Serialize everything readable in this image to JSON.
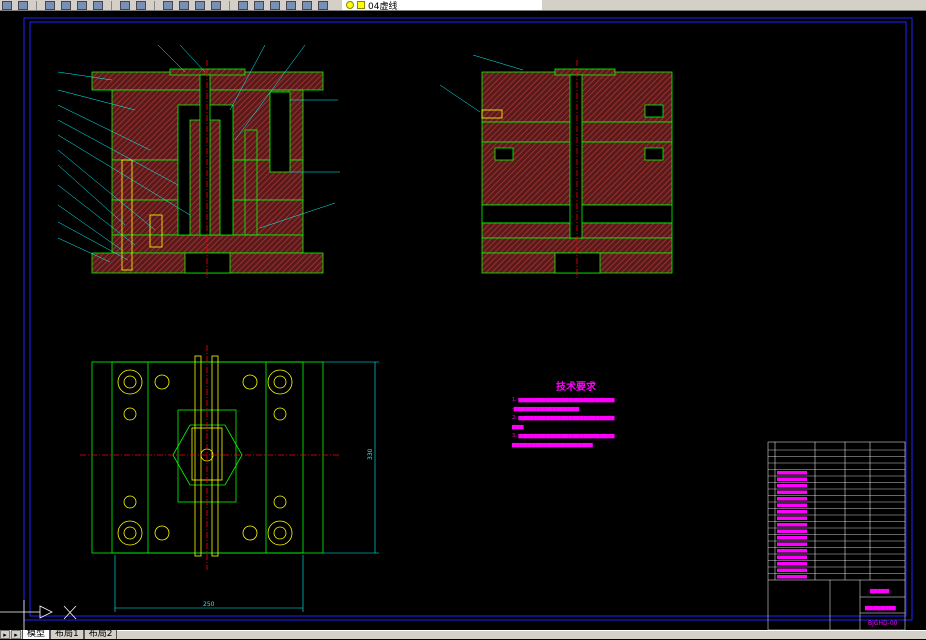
{
  "toolbar": {
    "layer_name": "04虚线",
    "icons": [
      "save-icon",
      "print-icon",
      "cut-icon",
      "copy-icon",
      "paste-icon",
      "match-properties-icon",
      "undo-icon",
      "redo-icon",
      "pan-icon",
      "zoom-realtime-icon",
      "zoom-window-icon",
      "zoom-previous-icon",
      "properties-icon",
      "design-center-icon",
      "tool-palettes-icon",
      "calculator-icon",
      "help-icon",
      "layers-icon"
    ]
  },
  "drawing": {
    "tech_title": "技术要求",
    "tech_lines": [
      "1. ▆▆▆▆▆▆▆▆▆▆▆▆▆▆▆▆▆▆▆▆▆▆▆▆▆",
      "-▆▆▆▆▆▆▆▆▆▆▆▆▆▆▆▆▆",
      "2. ▆▆▆▆▆▆▆▆▆▆▆▆▆▆▆▆▆▆▆▆▆▆▆▆▆",
      "▆▆▆",
      "3. ▆▆▆▆▆▆▆▆▆▆▆▆▆▆▆▆▆▆▆▆▆▆▆▆▆",
      "▆▆▆▆▆▆▆▆▆▆▆▆▆▆▆▆▆▆▆▆▆"
    ],
    "dim_width": "250",
    "dim_height": "330",
    "title_block": {
      "school": "▆▆▆▆▆",
      "drawing_name": "▆▆▆▆▆▆▆▆",
      "drawing_number": "BJGHD-00"
    },
    "colors": {
      "background": "#000000",
      "hatch": "#8b2a2a",
      "outline": "#00ff00",
      "dimension": "#00ffff",
      "text": "#ff00ff",
      "border": "#0000ff",
      "centerline": "#ff0000",
      "fastener": "#ffff00"
    }
  },
  "tabs": [
    {
      "label": "模型",
      "active": true
    },
    {
      "label": "布局1",
      "active": false
    },
    {
      "label": "布局2",
      "active": false
    }
  ]
}
